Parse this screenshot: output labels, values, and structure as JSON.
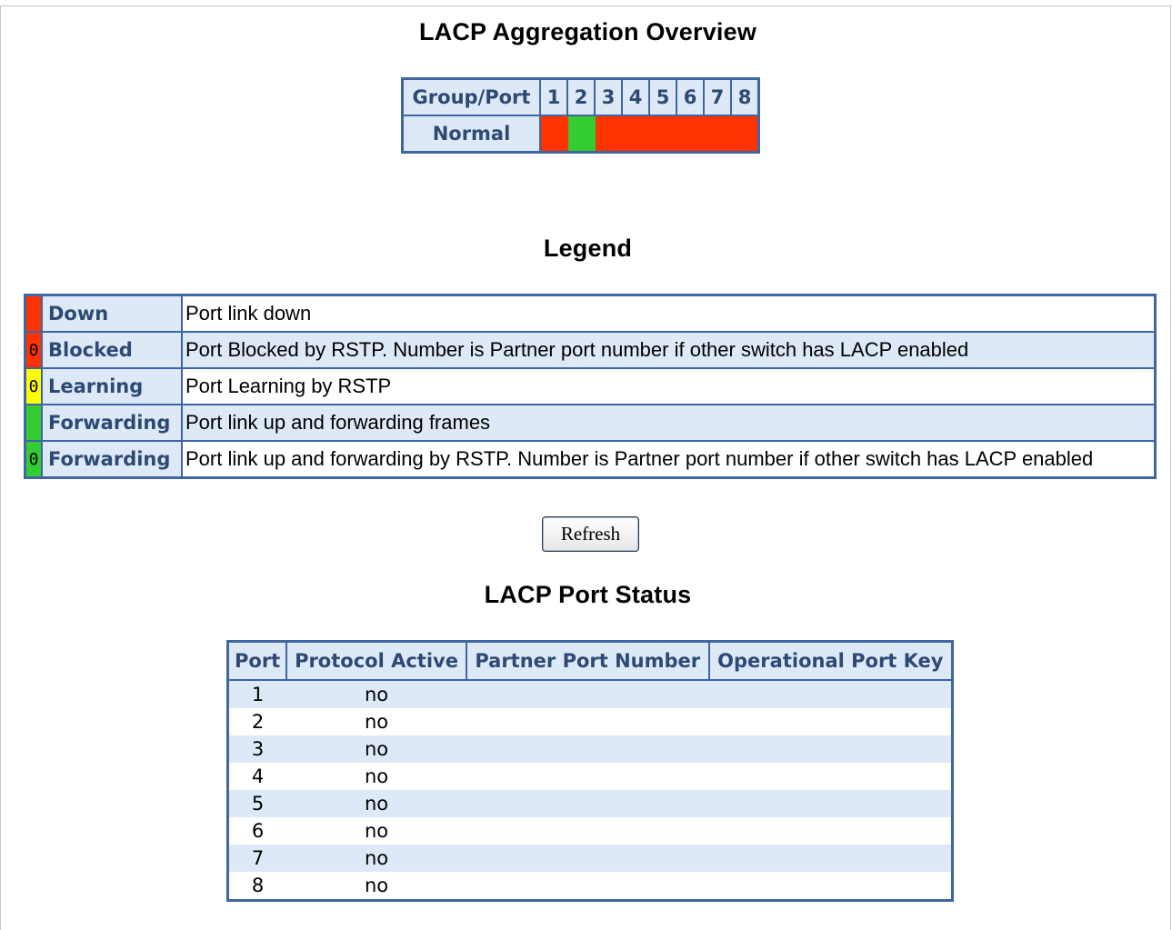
{
  "overview": {
    "title": "LACP Aggregation Overview",
    "header_label": "Group/Port",
    "ports": [
      "1",
      "2",
      "3",
      "4",
      "5",
      "6",
      "7",
      "8"
    ],
    "row_label": "Normal",
    "port_states": [
      "down",
      "forwarding",
      "down",
      "down",
      "down",
      "down",
      "down",
      "down"
    ]
  },
  "legend": {
    "title": "Legend",
    "items": [
      {
        "swatch_color": "#ff3300",
        "swatch_text": "",
        "name": "Down",
        "description": "Port link down"
      },
      {
        "swatch_color": "#ff3300",
        "swatch_text": "0",
        "name": "Blocked",
        "description": "Port Blocked by RSTP. Number is Partner port number if other switch has LACP enabled"
      },
      {
        "swatch_color": "#ffff00",
        "swatch_text": "0",
        "name": "Learning",
        "description": "Port Learning by RSTP"
      },
      {
        "swatch_color": "#33cc33",
        "swatch_text": "",
        "name": "Forwarding",
        "description": "Port link up and forwarding frames"
      },
      {
        "swatch_color": "#33cc33",
        "swatch_text": "0",
        "name": "Forwarding",
        "description": "Port link up and forwarding by RSTP. Number is Partner port number if other switch has LACP enabled"
      }
    ]
  },
  "refresh_label": "Refresh",
  "status": {
    "title": "LACP Port Status",
    "columns": [
      "Port",
      "Protocol Active",
      "Partner Port Number",
      "Operational Port Key"
    ],
    "rows": [
      {
        "port": "1",
        "protocol_active": "no",
        "partner_port": "",
        "port_key": ""
      },
      {
        "port": "2",
        "protocol_active": "no",
        "partner_port": "",
        "port_key": ""
      },
      {
        "port": "3",
        "protocol_active": "no",
        "partner_port": "",
        "port_key": ""
      },
      {
        "port": "4",
        "protocol_active": "no",
        "partner_port": "",
        "port_key": ""
      },
      {
        "port": "5",
        "protocol_active": "no",
        "partner_port": "",
        "port_key": ""
      },
      {
        "port": "6",
        "protocol_active": "no",
        "partner_port": "",
        "port_key": ""
      },
      {
        "port": "7",
        "protocol_active": "no",
        "partner_port": "",
        "port_key": ""
      },
      {
        "port": "8",
        "protocol_active": "no",
        "partner_port": "",
        "port_key": ""
      }
    ]
  },
  "colors": {
    "down": "#ff3300",
    "forwarding": "#33cc33",
    "header_bg": "#dee9f7",
    "border": "#3f66a3"
  }
}
